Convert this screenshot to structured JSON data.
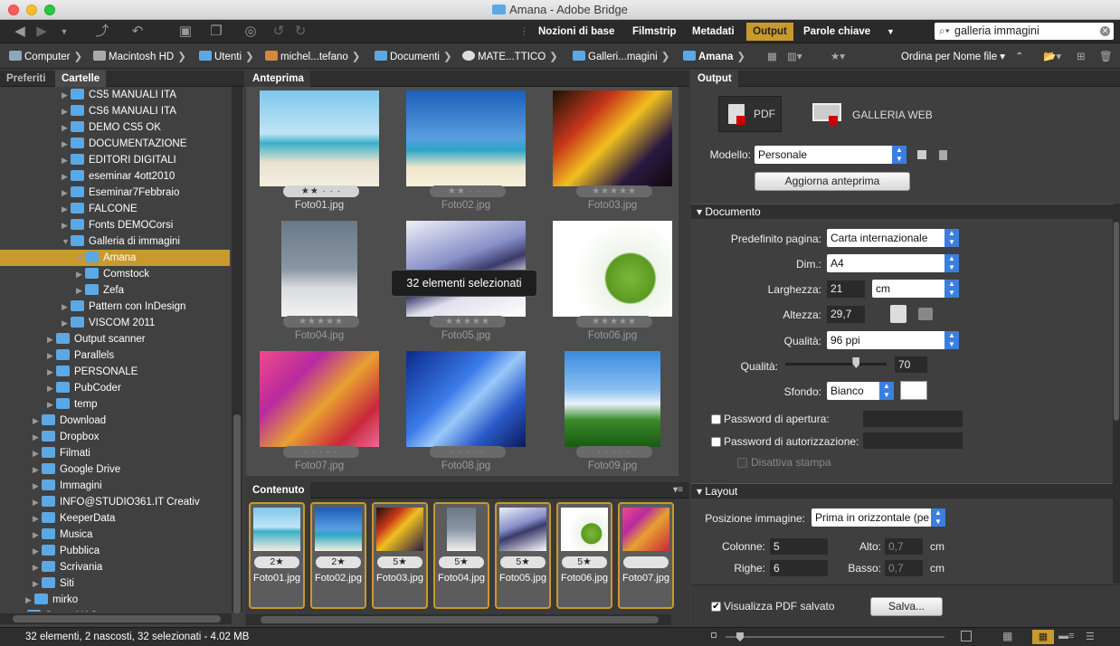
{
  "window": {
    "title": "Amana - Adobe Bridge"
  },
  "workspaces": {
    "items": [
      "Nozioni di base",
      "Filmstrip",
      "Metadati",
      "Output",
      "Parole chiave"
    ],
    "active": "Output",
    "more_label": "▼"
  },
  "search": {
    "value": "galleria immagini"
  },
  "path": [
    "Computer",
    "Macintosh HD",
    "Utenti",
    "michel...tefano",
    "Documenti",
    "MATE...TTICO",
    "Galleri...magini",
    "Amana"
  ],
  "sort_label": "Ordina per Nome file",
  "left_panel": {
    "tabs": [
      "Preferiti",
      "Cartelle"
    ],
    "active_tab": "Cartelle",
    "tree": [
      {
        "label": "CS5 MANUALI ITA",
        "indent": 3,
        "open": false
      },
      {
        "label": "CS6 MANUALI ITA",
        "indent": 3,
        "open": false
      },
      {
        "label": "DEMO CS5 OK",
        "indent": 3,
        "open": false
      },
      {
        "label": "DOCUMENTAZIONE",
        "indent": 3,
        "open": false
      },
      {
        "label": "EDITORI DIGITALI",
        "indent": 3,
        "open": false
      },
      {
        "label": "eseminar 4ott2010",
        "indent": 3,
        "open": false
      },
      {
        "label": "Eseminar7Febbraio",
        "indent": 3,
        "open": false
      },
      {
        "label": "FALCONE",
        "indent": 3,
        "open": false
      },
      {
        "label": "Fonts DEMOCorsi",
        "indent": 3,
        "open": false
      },
      {
        "label": "Galleria di immagini",
        "indent": 3,
        "open": true
      },
      {
        "label": "Amana",
        "indent": 4,
        "open": true,
        "selected": true
      },
      {
        "label": "Comstock",
        "indent": 4,
        "open": false
      },
      {
        "label": "Zefa",
        "indent": 4,
        "open": false
      },
      {
        "label": "Pattern con InDesign",
        "indent": 3,
        "open": false
      },
      {
        "label": "VISCOM 2011",
        "indent": 3,
        "open": false
      },
      {
        "label": "Output scanner",
        "indent": 2,
        "open": false
      },
      {
        "label": "Parallels",
        "indent": 2,
        "open": false
      },
      {
        "label": "PERSONALE",
        "indent": 2,
        "open": false
      },
      {
        "label": "PubCoder",
        "indent": 2,
        "open": false
      },
      {
        "label": "temp",
        "indent": 2,
        "open": false
      },
      {
        "label": "Download",
        "indent": 1,
        "open": false
      },
      {
        "label": "Dropbox",
        "indent": 1,
        "open": false
      },
      {
        "label": "Filmati",
        "indent": 1,
        "open": false
      },
      {
        "label": "Google Drive",
        "indent": 1,
        "open": false
      },
      {
        "label": "Immagini",
        "indent": 1,
        "open": false
      },
      {
        "label": "INFO@STUDIO361.IT Creativ",
        "indent": 1,
        "open": false
      },
      {
        "label": "KeeperData",
        "indent": 1,
        "open": false
      },
      {
        "label": "Musica",
        "indent": 1,
        "open": false
      },
      {
        "label": "Pubblica",
        "indent": 1,
        "open": false
      },
      {
        "label": "Scrivania",
        "indent": 1,
        "open": false
      },
      {
        "label": "Siti",
        "indent": 1,
        "open": false
      },
      {
        "label": "mirko",
        "indent": 0.5,
        "open": false
      },
      {
        "label": "ServerNAS",
        "indent": 0,
        "open": false
      }
    ]
  },
  "preview_panel": {
    "tab": "Anteprima",
    "tooltip": "32 elementi selezionati",
    "thumbs": [
      {
        "name": "Foto01.jpg",
        "stars": "★★ · · ·",
        "dim": false
      },
      {
        "name": "Foto02.jpg",
        "stars": "★★ · · ·",
        "dim": true
      },
      {
        "name": "Foto03.jpg",
        "stars": "★★★★★",
        "dim": true
      },
      {
        "name": "Foto04.jpg",
        "stars": "★★★★★",
        "dim": true
      },
      {
        "name": "Foto05.jpg",
        "stars": "★★★★★",
        "dim": true
      },
      {
        "name": "Foto06.jpg",
        "stars": "★★★★★",
        "dim": true
      },
      {
        "name": "Foto07.jpg",
        "stars": "· · · · ·",
        "dim": true
      },
      {
        "name": "Foto08.jpg",
        "stars": "· · · · ·",
        "dim": true
      },
      {
        "name": "Foto09.jpg",
        "stars": "· · · · ·",
        "dim": true
      }
    ]
  },
  "content_panel": {
    "tab": "Contenuto",
    "items": [
      {
        "name": "Foto01.jpg",
        "stars": "2★"
      },
      {
        "name": "Foto02.jpg",
        "stars": "2★"
      },
      {
        "name": "Foto03.jpg",
        "stars": "5★"
      },
      {
        "name": "Foto04.jpg",
        "stars": "5★"
      },
      {
        "name": "Foto05.jpg",
        "stars": "5★"
      },
      {
        "name": "Foto06.jpg",
        "stars": "5★"
      },
      {
        "name": "Foto07.jpg",
        "stars": ""
      }
    ]
  },
  "output_panel": {
    "tab": "Output",
    "pdf_label": "PDF",
    "gallery_label": "GALLERIA WEB",
    "modello_label": "Modello:",
    "modello_value": "Personale",
    "aggiorna_label": "Aggiorna anteprima",
    "documento_section": "Documento",
    "predefinito_label": "Predefinito pagina:",
    "predefinito_value": "Carta internazionale",
    "dim_label": "Dim.:",
    "dim_value": "A4",
    "larghezza_label": "Larghezza:",
    "larghezza_value": "21",
    "unit_value": "cm",
    "altezza_label": "Altezza:",
    "altezza_value": "29,7",
    "qualita_ppi_label": "Qualità:",
    "qualita_ppi_value": "96 ppi",
    "qualita_label": "Qualità:",
    "qualita_value": "70",
    "qualita_slider": 0.7,
    "sfondo_label": "Sfondo:",
    "sfondo_value": "Bianco",
    "pwd_apertura_label": "Password di apertura:",
    "pwd_autorizzazione_label": "Password di autorizzazione:",
    "disattiva_label": "Disattiva stampa",
    "layout_section": "Layout",
    "posizione_label": "Posizione immagine:",
    "posizione_value": "Prima in orizzontale (pe",
    "colonne_label": "Colonne:",
    "colonne_value": "5",
    "righe_label": "Righe:",
    "righe_value": "6",
    "alto_label": "Alto:",
    "alto_value": "0,7",
    "alto_unit": "cm",
    "basso_label": "Basso:",
    "basso_value": "0,7",
    "basso_unit": "cm",
    "visualizza_label": "Visualizza PDF salvato",
    "salva_label": "Salva..."
  },
  "status": {
    "text": "32 elementi, 2 nascosti, 32 selezionati - 4.02 MB"
  },
  "colors": {
    "accent": "#c89a2e",
    "folder": "#5aa9e6"
  }
}
